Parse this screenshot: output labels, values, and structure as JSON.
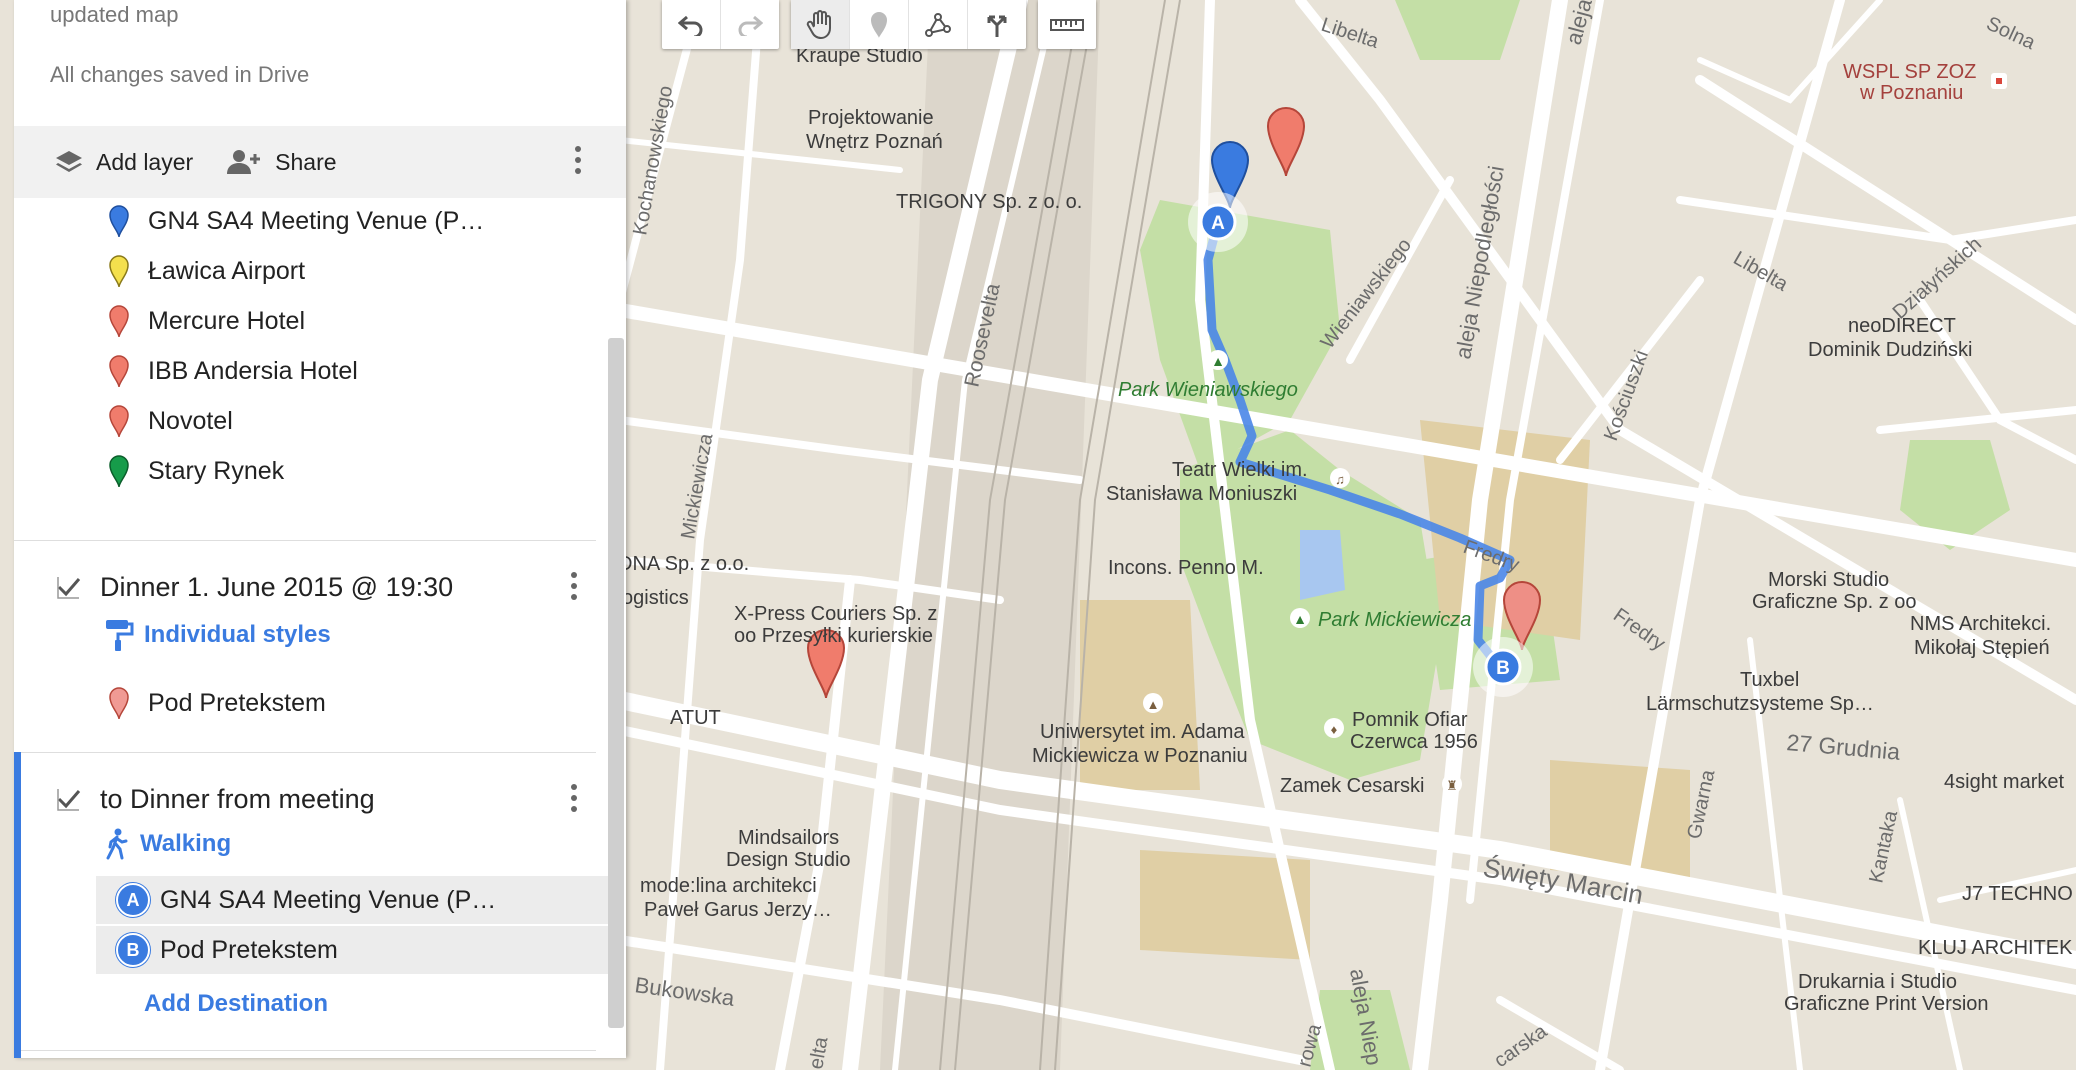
{
  "panel": {
    "map_title": "updated map",
    "save_status": "All changes saved in Drive",
    "actions": {
      "add_layer": "Add layer",
      "share": "Share"
    },
    "layer1": {
      "items": [
        {
          "label": "GN4 SA4 Meeting Venue (P…",
          "pin_color": "#3a7be0"
        },
        {
          "label": "Ławica Airport",
          "pin_color": "#f4e04d"
        },
        {
          "label": "Mercure Hotel",
          "pin_color": "#f07c6c"
        },
        {
          "label": "IBB Andersia Hotel",
          "pin_color": "#f07c6c"
        },
        {
          "label": "Novotel",
          "pin_color": "#f07c6c"
        },
        {
          "label": "Stary Rynek",
          "pin_color": "#169c4a"
        }
      ]
    },
    "layer2": {
      "title": "Dinner 1. June 2015 @ 19:30",
      "style_link": "Individual styles",
      "items": [
        {
          "label": "Pod Pretekstem",
          "pin_color": "#f09a94"
        }
      ]
    },
    "layer3": {
      "title": "to Dinner from meeting",
      "mode": "Walking",
      "waypoints": [
        {
          "badge": "A",
          "label": "GN4 SA4 Meeting Venue (P…"
        },
        {
          "badge": "B",
          "label": "Pod Pretekstem"
        }
      ],
      "add_destination": "Add Destination"
    }
  },
  "toolbar": {
    "buttons": [
      "undo-icon",
      "redo-icon",
      "hand-icon",
      "marker-icon",
      "draw-line-icon",
      "directions-icon",
      "ruler-icon"
    ],
    "active": "hand-icon"
  },
  "map": {
    "labels": {
      "kraupe": "Kraupe Studio",
      "projekt1": "Projektowanie",
      "projekt2": "Wnętrz Poznań",
      "trigony": "TRIGONY Sp. z o. o.",
      "libelta1": "Libelta",
      "libelta2": "Libelta",
      "solna": "Solna",
      "wspl1": "WSPL SP ZOZ",
      "wspl2": "w Poznaniu",
      "aleja1": "aleja Niepodległości",
      "aleja2": "aleja",
      "aleja3": "aleja Niep",
      "kochanowskiego": "Kochanowskiego",
      "roosevelta": "Roosevelta",
      "roosevelta2": "elta",
      "wieniawskiego": "Wieniawskiego",
      "park_wien": "Park Wieniawskiego",
      "dzialynskich": "Działyńskich",
      "neodirect1": "neoDIRECT",
      "neodirect2": "Dominik Dudziński",
      "kosciuszki": "Kościuszki",
      "mickiewicza": "Mickiewicza",
      "teatr1": "Teatr Wielki im.",
      "teatr2": "Stanisława Moniuszki",
      "fredry1": "Fredry",
      "fredry2": "Fredry",
      "incons": "Incons. Penno M.",
      "park_mick": "Park Mickiewicza",
      "dna": "DNA Sp. z o.o.",
      "logistics": "ogistics",
      "xpress1": "X-Press Couriers Sp. z",
      "xpress2": "oo Przesyłki kurierskie",
      "atut": "ATUT",
      "uni1": "Uniwersytet im. Adama",
      "uni2": "Mickiewicza w Poznaniu",
      "pomnik1": "Pomnik Ofiar",
      "pomnik2": "Czerwca 1956",
      "zamek": "Zamek Cesarski",
      "morski1": "Morski Studio",
      "morski2": "Graficzne Sp. z oo",
      "nms1": "NMS Architekci.",
      "nms2": "Mikołaj Stępień",
      "tuxbel1": "Tuxbel",
      "tuxbel2": "Lärmschutzsysteme Sp…",
      "grudnia": "27 Grudnia",
      "market": "4sight market",
      "gwarna": "Gwarna",
      "kantaka": "Kantaka",
      "swiety": "Święty Marcin",
      "j7": "J7 TECHNO",
      "kluj": "KLUJ ARCHITEK",
      "mindsailors1": "Mindsailors",
      "mindsailors2": "Design Studio",
      "modelina1": "mode:lina architekci",
      "modelina2": "Paweł Garus Jerzy…",
      "bukowska": "Bukowska",
      "drukarnia1": "Drukarnia i Studio",
      "drukarnia2": "Graficzne Print Version",
      "rowa": "rowa",
      "carska": "carska"
    },
    "route_badges": {
      "start": "A",
      "end": "B"
    },
    "route_color": "#4a86e8",
    "park_color": "#c4dfa6"
  }
}
